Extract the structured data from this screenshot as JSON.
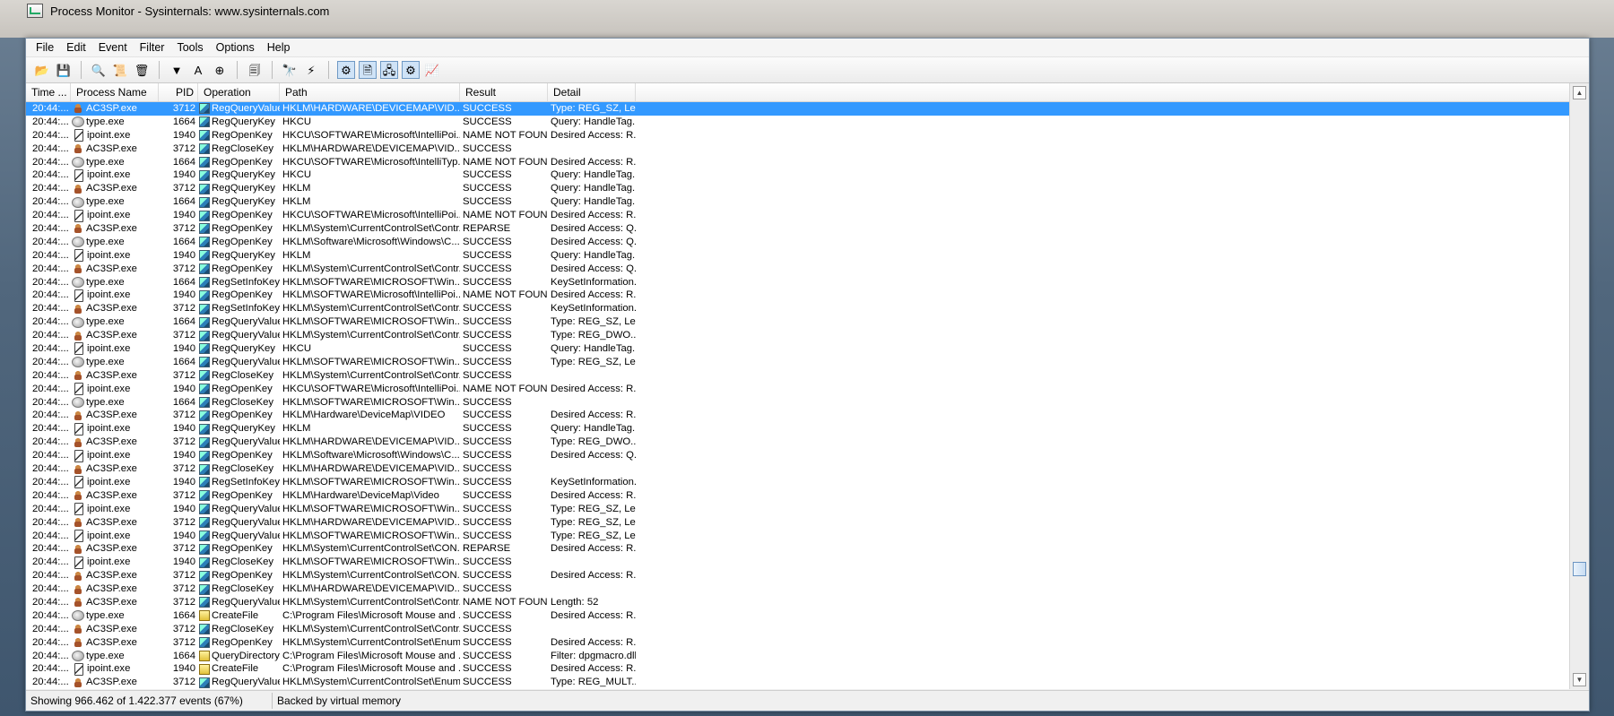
{
  "window": {
    "title": "Process Monitor - Sysinternals: www.sysinternals.com"
  },
  "menu": [
    "File",
    "Edit",
    "Event",
    "Filter",
    "Tools",
    "Options",
    "Help"
  ],
  "toolbar": {
    "groups": [
      [
        {
          "name": "open-icon",
          "glyph": "📂"
        },
        {
          "name": "save-icon",
          "glyph": "💾"
        }
      ],
      [
        {
          "name": "capture-icon",
          "glyph": "🔍"
        },
        {
          "name": "autoscroll-icon",
          "glyph": "📜"
        },
        {
          "name": "clear-icon",
          "glyph": "🗑"
        }
      ],
      [
        {
          "name": "filter-icon",
          "glyph": "▼"
        },
        {
          "name": "highlight-icon",
          "glyph": "A"
        },
        {
          "name": "target-icon",
          "glyph": "⊕"
        }
      ],
      [
        {
          "name": "process-tree-icon",
          "glyph": "🗐"
        }
      ],
      [
        {
          "name": "find-icon",
          "glyph": "🔭"
        },
        {
          "name": "jump-icon",
          "glyph": "⚡"
        }
      ],
      [
        {
          "name": "registry-activity-icon",
          "glyph": "⚙",
          "on": true
        },
        {
          "name": "file-activity-icon",
          "glyph": "🗎",
          "on": true
        },
        {
          "name": "network-activity-icon",
          "glyph": "🖧",
          "on": true
        },
        {
          "name": "process-activity-icon",
          "glyph": "⚙",
          "on": true
        },
        {
          "name": "profiling-icon",
          "glyph": "📈"
        }
      ]
    ]
  },
  "columns": {
    "time": "Time ...",
    "process": "Process Name",
    "pid": "PID",
    "operation": "Operation",
    "path": "Path",
    "result": "Result",
    "detail": "Detail"
  },
  "rows": [
    [
      "20:44:...",
      "AC3SP.exe",
      "3712",
      "RegQueryValue",
      "HKLM\\HARDWARE\\DEVICEMAP\\VID...",
      "SUCCESS",
      "Type: REG_SZ, Le...",
      "ac3sp",
      "reg",
      true
    ],
    [
      "20:44:...",
      "type.exe",
      "1664",
      "RegQueryKey",
      "HKCU",
      "SUCCESS",
      "Query: HandleTag...",
      "type",
      "reg"
    ],
    [
      "20:44:...",
      "ipoint.exe",
      "1940",
      "RegOpenKey",
      "HKCU\\SOFTWARE\\Microsoft\\IntelliPoi...",
      "NAME NOT FOUND",
      "Desired Access: R...",
      "ipoint",
      "reg"
    ],
    [
      "20:44:...",
      "AC3SP.exe",
      "3712",
      "RegCloseKey",
      "HKLM\\HARDWARE\\DEVICEMAP\\VID...",
      "SUCCESS",
      "",
      "ac3sp",
      "reg"
    ],
    [
      "20:44:...",
      "type.exe",
      "1664",
      "RegOpenKey",
      "HKCU\\SOFTWARE\\Microsoft\\IntelliTyp...",
      "NAME NOT FOUND",
      "Desired Access: R...",
      "type",
      "reg"
    ],
    [
      "20:44:...",
      "ipoint.exe",
      "1940",
      "RegQueryKey",
      "HKCU",
      "SUCCESS",
      "Query: HandleTag...",
      "ipoint",
      "reg"
    ],
    [
      "20:44:...",
      "AC3SP.exe",
      "3712",
      "RegQueryKey",
      "HKLM",
      "SUCCESS",
      "Query: HandleTag...",
      "ac3sp",
      "reg"
    ],
    [
      "20:44:...",
      "type.exe",
      "1664",
      "RegQueryKey",
      "HKLM",
      "SUCCESS",
      "Query: HandleTag...",
      "type",
      "reg"
    ],
    [
      "20:44:...",
      "ipoint.exe",
      "1940",
      "RegOpenKey",
      "HKCU\\SOFTWARE\\Microsoft\\IntelliPoi...",
      "NAME NOT FOUND",
      "Desired Access: R...",
      "ipoint",
      "reg"
    ],
    [
      "20:44:...",
      "AC3SP.exe",
      "3712",
      "RegOpenKey",
      "HKLM\\System\\CurrentControlSet\\Contr...",
      "REPARSE",
      "Desired Access: Q...",
      "ac3sp",
      "reg"
    ],
    [
      "20:44:...",
      "type.exe",
      "1664",
      "RegOpenKey",
      "HKLM\\Software\\Microsoft\\Windows\\C...",
      "SUCCESS",
      "Desired Access: Q...",
      "type",
      "reg"
    ],
    [
      "20:44:...",
      "ipoint.exe",
      "1940",
      "RegQueryKey",
      "HKLM",
      "SUCCESS",
      "Query: HandleTag...",
      "ipoint",
      "reg"
    ],
    [
      "20:44:...",
      "AC3SP.exe",
      "3712",
      "RegOpenKey",
      "HKLM\\System\\CurrentControlSet\\Contr...",
      "SUCCESS",
      "Desired Access: Q...",
      "ac3sp",
      "reg"
    ],
    [
      "20:44:...",
      "type.exe",
      "1664",
      "RegSetInfoKey",
      "HKLM\\SOFTWARE\\MICROSOFT\\Win...",
      "SUCCESS",
      "KeySetInformation...",
      "type",
      "reg"
    ],
    [
      "20:44:...",
      "ipoint.exe",
      "1940",
      "RegOpenKey",
      "HKLM\\SOFTWARE\\Microsoft\\IntelliPoi...",
      "NAME NOT FOUND",
      "Desired Access: R...",
      "ipoint",
      "reg"
    ],
    [
      "20:44:...",
      "AC3SP.exe",
      "3712",
      "RegSetInfoKey",
      "HKLM\\System\\CurrentControlSet\\Contr...",
      "SUCCESS",
      "KeySetInformation...",
      "ac3sp",
      "reg"
    ],
    [
      "20:44:...",
      "type.exe",
      "1664",
      "RegQueryValue",
      "HKLM\\SOFTWARE\\MICROSOFT\\Win...",
      "SUCCESS",
      "Type: REG_SZ, Le...",
      "type",
      "reg"
    ],
    [
      "20:44:...",
      "AC3SP.exe",
      "3712",
      "RegQueryValue",
      "HKLM\\System\\CurrentControlSet\\Contr...",
      "SUCCESS",
      "Type: REG_DWO...",
      "ac3sp",
      "reg"
    ],
    [
      "20:44:...",
      "ipoint.exe",
      "1940",
      "RegQueryKey",
      "HKCU",
      "SUCCESS",
      "Query: HandleTag...",
      "ipoint",
      "reg"
    ],
    [
      "20:44:...",
      "type.exe",
      "1664",
      "RegQueryValue",
      "HKLM\\SOFTWARE\\MICROSOFT\\Win...",
      "SUCCESS",
      "Type: REG_SZ, Le...",
      "type",
      "reg"
    ],
    [
      "20:44:...",
      "AC3SP.exe",
      "3712",
      "RegCloseKey",
      "HKLM\\System\\CurrentControlSet\\Contr...",
      "SUCCESS",
      "",
      "ac3sp",
      "reg"
    ],
    [
      "20:44:...",
      "ipoint.exe",
      "1940",
      "RegOpenKey",
      "HKCU\\SOFTWARE\\Microsoft\\IntelliPoi...",
      "NAME NOT FOUND",
      "Desired Access: R...",
      "ipoint",
      "reg"
    ],
    [
      "20:44:...",
      "type.exe",
      "1664",
      "RegCloseKey",
      "HKLM\\SOFTWARE\\MICROSOFT\\Win...",
      "SUCCESS",
      "",
      "type",
      "reg"
    ],
    [
      "20:44:...",
      "AC3SP.exe",
      "3712",
      "RegOpenKey",
      "HKLM\\Hardware\\DeviceMap\\VIDEO",
      "SUCCESS",
      "Desired Access: R...",
      "ac3sp",
      "reg"
    ],
    [
      "20:44:...",
      "ipoint.exe",
      "1940",
      "RegQueryKey",
      "HKLM",
      "SUCCESS",
      "Query: HandleTag...",
      "ipoint",
      "reg"
    ],
    [
      "20:44:...",
      "AC3SP.exe",
      "3712",
      "RegQueryValue",
      "HKLM\\HARDWARE\\DEVICEMAP\\VID...",
      "SUCCESS",
      "Type: REG_DWO...",
      "ac3sp",
      "reg"
    ],
    [
      "20:44:...",
      "ipoint.exe",
      "1940",
      "RegOpenKey",
      "HKLM\\Software\\Microsoft\\Windows\\C...",
      "SUCCESS",
      "Desired Access: Q...",
      "ipoint",
      "reg"
    ],
    [
      "20:44:...",
      "AC3SP.exe",
      "3712",
      "RegCloseKey",
      "HKLM\\HARDWARE\\DEVICEMAP\\VID...",
      "SUCCESS",
      "",
      "ac3sp",
      "reg"
    ],
    [
      "20:44:...",
      "ipoint.exe",
      "1940",
      "RegSetInfoKey",
      "HKLM\\SOFTWARE\\MICROSOFT\\Win...",
      "SUCCESS",
      "KeySetInformation...",
      "ipoint",
      "reg"
    ],
    [
      "20:44:...",
      "AC3SP.exe",
      "3712",
      "RegOpenKey",
      "HKLM\\Hardware\\DeviceMap\\Video",
      "SUCCESS",
      "Desired Access: R...",
      "ac3sp",
      "reg"
    ],
    [
      "20:44:...",
      "ipoint.exe",
      "1940",
      "RegQueryValue",
      "HKLM\\SOFTWARE\\MICROSOFT\\Win...",
      "SUCCESS",
      "Type: REG_SZ, Le...",
      "ipoint",
      "reg"
    ],
    [
      "20:44:...",
      "AC3SP.exe",
      "3712",
      "RegQueryValue",
      "HKLM\\HARDWARE\\DEVICEMAP\\VID...",
      "SUCCESS",
      "Type: REG_SZ, Le...",
      "ac3sp",
      "reg"
    ],
    [
      "20:44:...",
      "ipoint.exe",
      "1940",
      "RegQueryValue",
      "HKLM\\SOFTWARE\\MICROSOFT\\Win...",
      "SUCCESS",
      "Type: REG_SZ, Le...",
      "ipoint",
      "reg"
    ],
    [
      "20:44:...",
      "AC3SP.exe",
      "3712",
      "RegOpenKey",
      "HKLM\\System\\CurrentControlSet\\CON...",
      "REPARSE",
      "Desired Access: R...",
      "ac3sp",
      "reg"
    ],
    [
      "20:44:...",
      "ipoint.exe",
      "1940",
      "RegCloseKey",
      "HKLM\\SOFTWARE\\MICROSOFT\\Win...",
      "SUCCESS",
      "",
      "ipoint",
      "reg"
    ],
    [
      "20:44:...",
      "AC3SP.exe",
      "3712",
      "RegOpenKey",
      "HKLM\\System\\CurrentControlSet\\CON...",
      "SUCCESS",
      "Desired Access: R...",
      "ac3sp",
      "reg"
    ],
    [
      "20:44:...",
      "AC3SP.exe",
      "3712",
      "RegCloseKey",
      "HKLM\\HARDWARE\\DEVICEMAP\\VID...",
      "SUCCESS",
      "",
      "ac3sp",
      "reg"
    ],
    [
      "20:44:...",
      "AC3SP.exe",
      "3712",
      "RegQueryValue",
      "HKLM\\System\\CurrentControlSet\\Contr...",
      "NAME NOT FOUND",
      "Length: 52",
      "ac3sp",
      "reg"
    ],
    [
      "20:44:...",
      "type.exe",
      "1664",
      "CreateFile",
      "C:\\Program Files\\Microsoft Mouse and ...",
      "SUCCESS",
      "Desired Access: R...",
      "type",
      "file"
    ],
    [
      "20:44:...",
      "AC3SP.exe",
      "3712",
      "RegCloseKey",
      "HKLM\\System\\CurrentControlSet\\Contr...",
      "SUCCESS",
      "",
      "ac3sp",
      "reg"
    ],
    [
      "20:44:...",
      "AC3SP.exe",
      "3712",
      "RegOpenKey",
      "HKLM\\System\\CurrentControlSet\\Enum...",
      "SUCCESS",
      "Desired Access: R...",
      "ac3sp",
      "reg"
    ],
    [
      "20:44:...",
      "type.exe",
      "1664",
      "QueryDirectory",
      "C:\\Program Files\\Microsoft Mouse and ...",
      "SUCCESS",
      "Filter: dpgmacro.dll,...",
      "type",
      "file"
    ],
    [
      "20:44:...",
      "ipoint.exe",
      "1940",
      "CreateFile",
      "C:\\Program Files\\Microsoft Mouse and ...",
      "SUCCESS",
      "Desired Access: R...",
      "ipoint",
      "file"
    ],
    [
      "20:44:...",
      "AC3SP.exe",
      "3712",
      "RegQueryValue",
      "HKLM\\System\\CurrentControlSet\\Enum...",
      "SUCCESS",
      "Type: REG_MULT...",
      "ac3sp",
      "reg"
    ]
  ],
  "status": {
    "events": "Showing 966.462 of 1.422.377 events (67%)",
    "memory": "Backed by virtual memory"
  },
  "colors": {
    "selection": "#3399ff",
    "window_bg": "#f0f0f0"
  }
}
